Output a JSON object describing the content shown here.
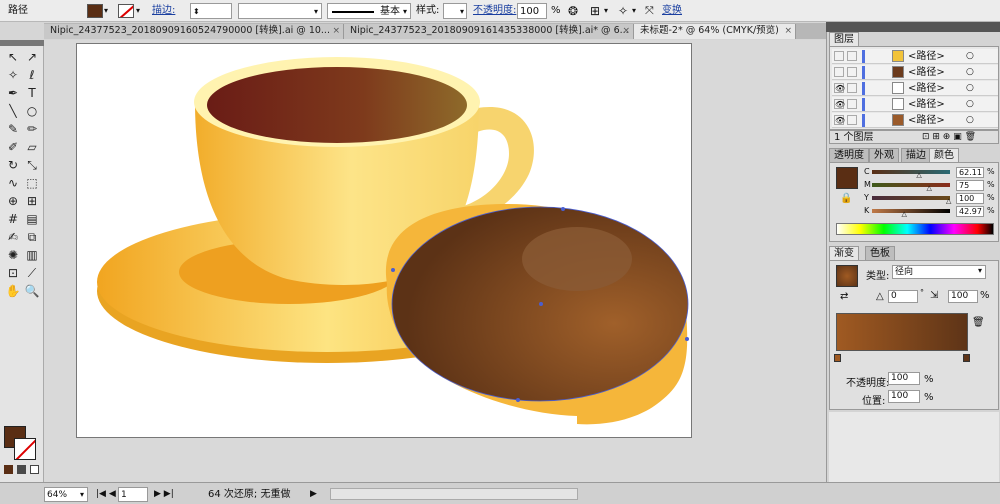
{
  "controlbar": {
    "object_label": "路径",
    "stroke_label": "描边:",
    "stroke_profile_label": "基本",
    "style_label": "样式:",
    "opacity_label": "不透明度:",
    "opacity_value": "100",
    "opacity_unit": "%",
    "transform_label": "变换",
    "fill_color": "#5a2e14"
  },
  "tabs": [
    {
      "label": "Nipic_24377523_20180909160524790000  [转换].ai @ 10...",
      "close": "×"
    },
    {
      "label": "Nipic_24377523_20180909161435338000  [转换].ai* @ 6...",
      "close": "×"
    },
    {
      "label": "未标题-2* @ 64% (CMYK/预览)",
      "close": "×"
    }
  ],
  "tools": [
    {
      "icon": "selection-icon",
      "glyph": "↖"
    },
    {
      "icon": "direct-selection-icon",
      "glyph": "↗"
    },
    {
      "icon": "magic-wand-icon",
      "glyph": "✧"
    },
    {
      "icon": "lasso-icon",
      "glyph": "ℓ"
    },
    {
      "icon": "pen-icon",
      "glyph": "✒"
    },
    {
      "icon": "type-icon",
      "glyph": "T"
    },
    {
      "icon": "line-icon",
      "glyph": "╲"
    },
    {
      "icon": "ellipse-icon",
      "glyph": "○"
    },
    {
      "icon": "paintbrush-icon",
      "glyph": "✎"
    },
    {
      "icon": "pencil-icon",
      "glyph": "✏"
    },
    {
      "icon": "blob-brush-icon",
      "glyph": "✐"
    },
    {
      "icon": "eraser-icon",
      "glyph": "▱"
    },
    {
      "icon": "rotate-icon",
      "glyph": "↻"
    },
    {
      "icon": "scale-icon",
      "glyph": "⤡"
    },
    {
      "icon": "warp-icon",
      "glyph": "∿"
    },
    {
      "icon": "free-transform-icon",
      "glyph": "⬚"
    },
    {
      "icon": "shape-builder-icon",
      "glyph": "⊕"
    },
    {
      "icon": "perspective-icon",
      "glyph": "⊞"
    },
    {
      "icon": "mesh-icon",
      "glyph": "#"
    },
    {
      "icon": "gradient-icon",
      "glyph": "▤"
    },
    {
      "icon": "eyedropper-icon",
      "glyph": "✍"
    },
    {
      "icon": "blend-icon",
      "glyph": "⧉"
    },
    {
      "icon": "symbol-sprayer-icon",
      "glyph": "✺"
    },
    {
      "icon": "column-graph-icon",
      "glyph": "▥"
    },
    {
      "icon": "artboard-icon",
      "glyph": "⊡"
    },
    {
      "icon": "slice-icon",
      "glyph": "⟋"
    },
    {
      "icon": "hand-icon",
      "glyph": "✋"
    },
    {
      "icon": "zoom-icon",
      "glyph": "🔍"
    }
  ],
  "layers_panel": {
    "tab": "图层",
    "rows": [
      {
        "name": "<路径>",
        "thumb": "#f2c33a"
      },
      {
        "name": "<路径>",
        "thumb": "#6b3a1c"
      },
      {
        "name": "<路径>",
        "thumb": "#ffffff"
      },
      {
        "name": "<路径>",
        "thumb": "#ffffff"
      },
      {
        "name": "<路径>",
        "thumb": "#9a5a2a"
      }
    ],
    "count_label": "1 个图层"
  },
  "color_panel": {
    "tabs": [
      "透明度",
      "外观",
      "描边",
      "颜色"
    ],
    "channels": [
      {
        "name": "C",
        "value": "62.11",
        "fill": 0.62,
        "grad": "linear-gradient(90deg,#5a2e14,#2a6a74)"
      },
      {
        "name": "M",
        "value": "75",
        "fill": 0.75,
        "grad": "linear-gradient(90deg,#3f5a1a,#8a2c1c)"
      },
      {
        "name": "Y",
        "value": "100",
        "fill": 1.0,
        "grad": "linear-gradient(90deg,#4a2c3c,#6a4a1a)"
      },
      {
        "name": "K",
        "value": "42.97",
        "fill": 0.43,
        "grad": "linear-gradient(90deg,#c07a48,#000000)"
      }
    ],
    "fill_color": "#5a2e14"
  },
  "gradient_panel": {
    "tabs": [
      "渐变",
      "色板"
    ],
    "type_label": "类型:",
    "type_value": "径向",
    "angle": "0",
    "ratio": "100",
    "opacity_label": "不透明度:",
    "opacity_value": "100",
    "location_label": "位置:",
    "location_value": "100",
    "unit": "%",
    "stop_left": "#a05a22",
    "stop_right": "#5e3417"
  },
  "status_bar": {
    "zoom": "64%",
    "artboard": "1",
    "info": "64 次还原; 无重做"
  }
}
